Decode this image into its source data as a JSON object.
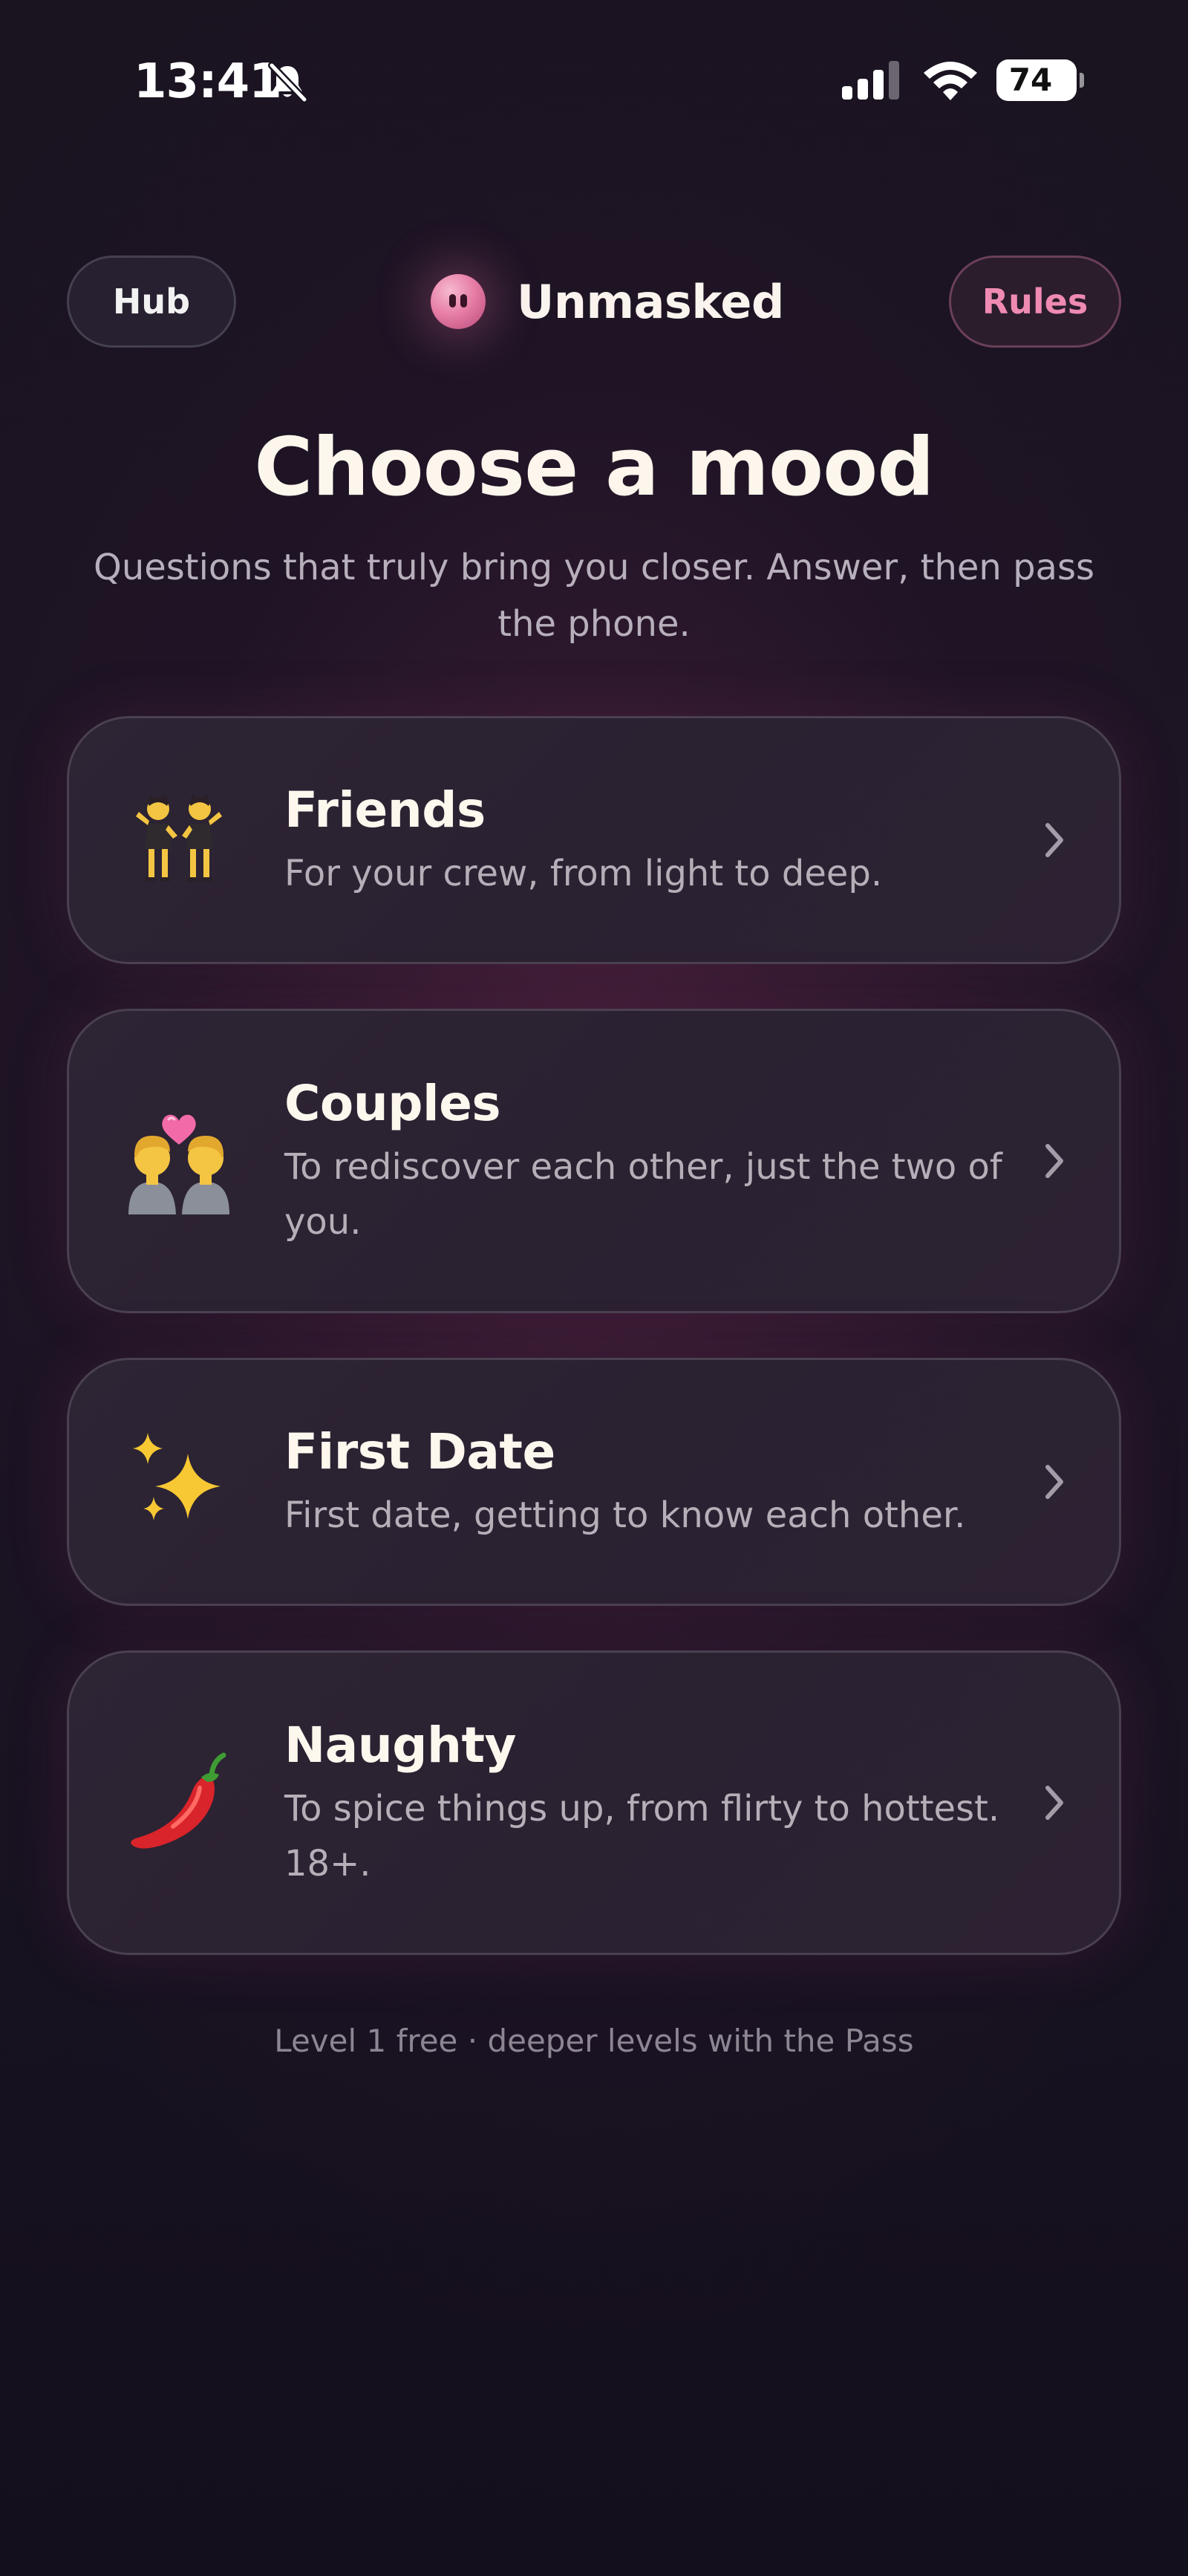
{
  "status_bar": {
    "time": "13:41",
    "battery_level": "74",
    "icons": [
      "bell-slash-icon",
      "cellular-signal-icon",
      "wifi-icon",
      "battery-icon"
    ]
  },
  "header": {
    "hub_label": "Hub",
    "brand_name": "Unmasked",
    "rules_label": "Rules"
  },
  "title": "Choose a mood",
  "subtitle": "Questions that truly bring you closer. Answer, then pass the phone.",
  "moods": [
    {
      "title": "Friends",
      "description": "For your crew, from light to deep.",
      "icon": "two-women-dancing-icon"
    },
    {
      "title": "Couples",
      "description": "To rediscover each other, just the two of you.",
      "icon": "couple-with-heart-icon"
    },
    {
      "title": "First Date",
      "description": "First date, getting to know each other.",
      "icon": "sparkles-icon"
    },
    {
      "title": "Naughty",
      "description": "To spice things up, from flirty to hottest. 18+.",
      "icon": "chili-pepper-icon"
    }
  ],
  "footer": "Level 1 free · deeper levels with the Pass",
  "colors": {
    "background": "#1a1320",
    "card_background": "#2b2232",
    "card_border": "#4a4150",
    "accent_pink": "#ef8ab2",
    "title_text": "#fdf6ec",
    "muted_text": "#b7afbb"
  }
}
